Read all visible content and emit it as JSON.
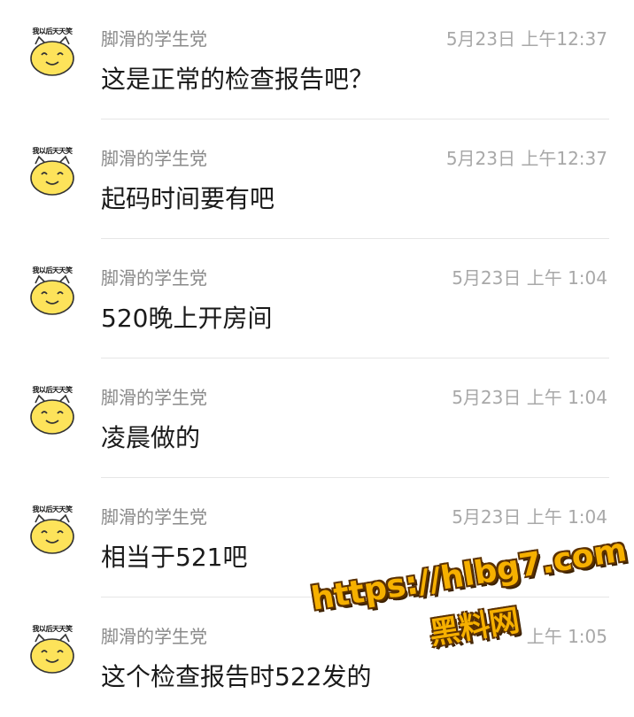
{
  "messages": [
    {
      "sender": "脚滑的学生党",
      "time": "5月23日 上午12:37",
      "text": "这是正常的检查报告吧？",
      "avatar_caption": "我以后天天笑"
    },
    {
      "sender": "脚滑的学生党",
      "time": "5月23日 上午12:37",
      "text": "起码时间要有吧",
      "avatar_caption": "我以后天天笑"
    },
    {
      "sender": "脚滑的学生党",
      "time": "5月23日 上午 1:04",
      "text": "520晚上开房间",
      "avatar_caption": "我以后天天笑"
    },
    {
      "sender": "脚滑的学生党",
      "time": "5月23日 上午 1:04",
      "text": "凌晨做的",
      "avatar_caption": "我以后天天笑"
    },
    {
      "sender": "脚滑的学生党",
      "time": "5月23日 上午 1:04",
      "text": "相当于521吧",
      "avatar_caption": "我以后天天笑"
    },
    {
      "sender": "脚滑的学生党",
      "time": "上午 1:05",
      "text": "这个检查报告时522发的",
      "avatar_caption": "我以后天天笑"
    }
  ],
  "watermark": {
    "url": "https://hlbg7.com",
    "site": "黑料网"
  },
  "colors": {
    "sender": "#8a8a8a",
    "time": "#a8a8a8",
    "text": "#1a1a1a",
    "divider": "#e6e6e6",
    "avatar_face": "#fde35a",
    "watermark": "#f6b000"
  }
}
